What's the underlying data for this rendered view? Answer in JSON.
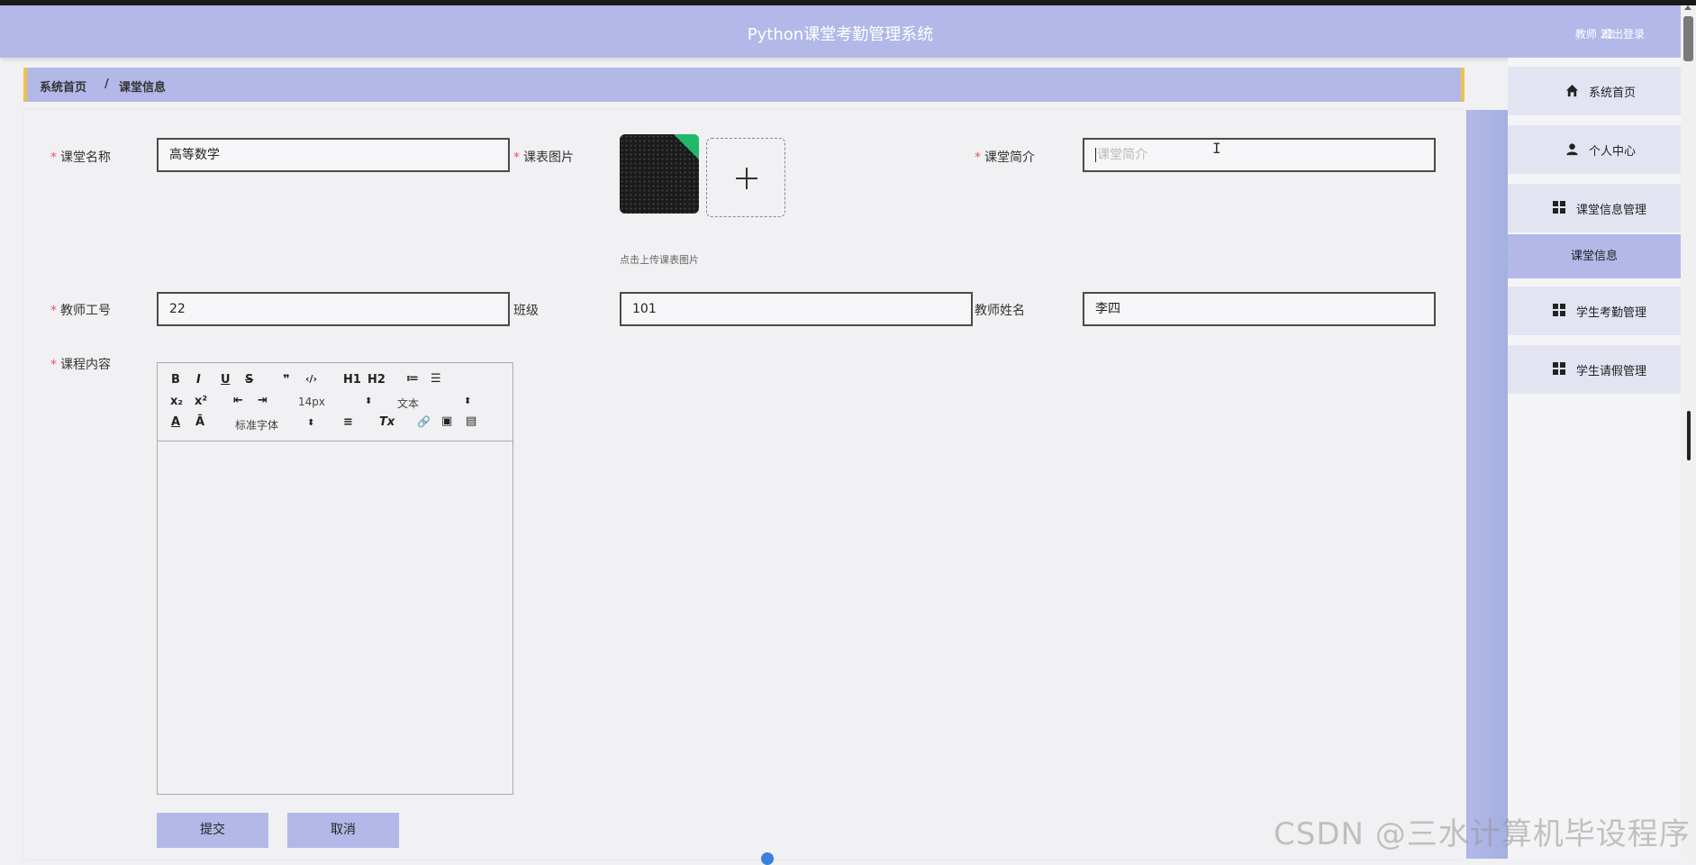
{
  "header": {
    "title": "Python课堂考勤管理系统",
    "user": "教师 22",
    "logout": "退出登录"
  },
  "breadcrumb": {
    "home": "系统首页",
    "separator": "/",
    "current": "课堂信息"
  },
  "form": {
    "course_name": {
      "label": "课堂名称",
      "value": "高等数学"
    },
    "schedule_image": {
      "label": "课表图片",
      "hint": "点击上传课表图片",
      "plus": "+"
    },
    "intro": {
      "label": "课堂简介",
      "placeholder": "课堂简介"
    },
    "teacher_id": {
      "label": "教师工号",
      "value": "22"
    },
    "class": {
      "label": "班级",
      "value": "101"
    },
    "teacher_name": {
      "label": "教师姓名",
      "value": "李四"
    },
    "content": {
      "label": "课程内容"
    },
    "required_mark": "*"
  },
  "editor": {
    "bold": "B",
    "italic": "I",
    "underline": "U",
    "strike": "S",
    "quote": "❞",
    "code": "‹/›",
    "h1": "H1",
    "h2": "H2",
    "ol": "≔",
    "ul": "☰",
    "sub": "x₂",
    "sup": "x²",
    "outdent": "⇤",
    "indent": "⇥",
    "size": "14px",
    "header": "文本",
    "color": "A",
    "background": "Ā",
    "font": "标准字体",
    "align": "≡",
    "clean": "Tx",
    "link": "🔗",
    "image": "▣",
    "video": "▤"
  },
  "buttons": {
    "submit": "提交",
    "cancel": "取消"
  },
  "sidebar": {
    "items": [
      {
        "label": "系统首页",
        "icon": "home-icon"
      },
      {
        "label": "个人中心",
        "icon": "user-icon"
      },
      {
        "label": "课堂信息管理",
        "icon": "grid-icon"
      },
      {
        "label": "学生考勤管理",
        "icon": "grid-icon"
      },
      {
        "label": "学生请假管理",
        "icon": "grid-icon"
      }
    ],
    "submenu": "课堂信息"
  },
  "watermark": "CSDN @三水计算机毕设程序",
  "colors": {
    "accent": "#b3b8e8",
    "breadcrumb_border": "#efc24c",
    "required": "#e25a5a"
  }
}
